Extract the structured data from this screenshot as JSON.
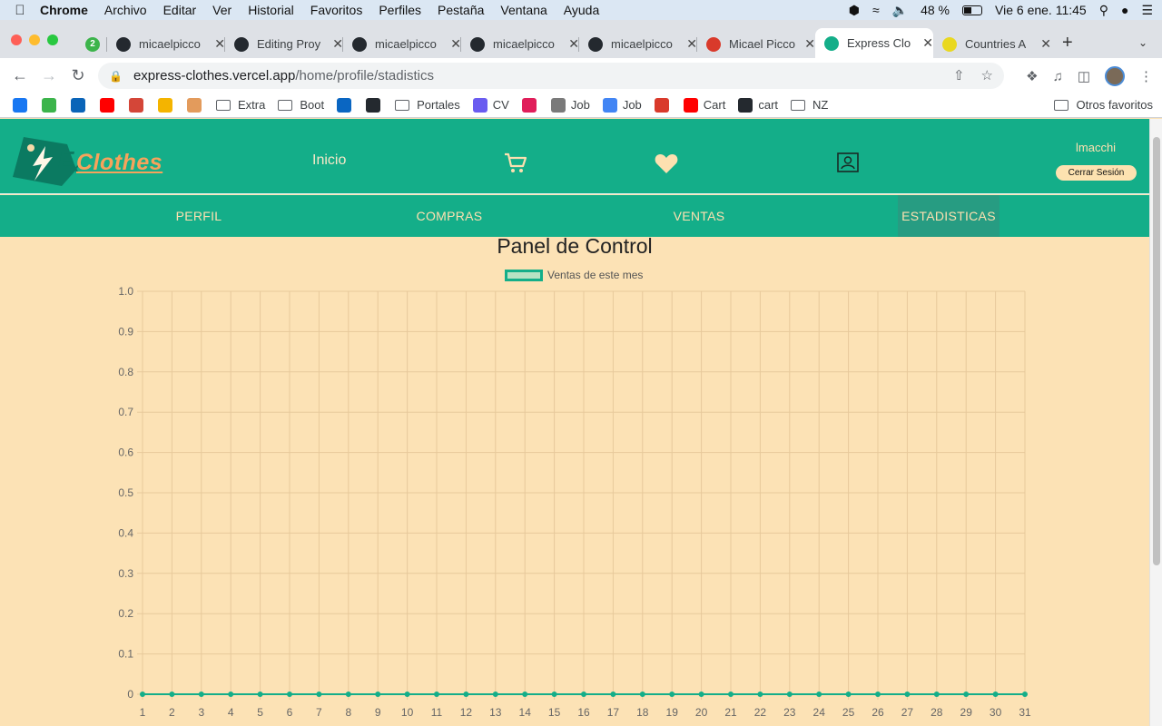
{
  "menubar": {
    "app": "Chrome",
    "items": [
      "Archivo",
      "Editar",
      "Ver",
      "Historial",
      "Favoritos",
      "Perfiles",
      "Pestaña",
      "Ventana",
      "Ayuda"
    ],
    "battery": "48 %",
    "battery_level": 0.48,
    "datetime": "Vie 6 ene.  11:45"
  },
  "tabs": [
    {
      "title": "",
      "badge": "2",
      "color": "#3cb44b"
    },
    {
      "title": "micaelpicco",
      "color": "#24292f"
    },
    {
      "title": "Editing Proy",
      "color": "#24292f"
    },
    {
      "title": "micaelpicco",
      "color": "#24292f"
    },
    {
      "title": "micaelpicco",
      "color": "#24292f"
    },
    {
      "title": "micaelpicco",
      "color": "#24292f"
    },
    {
      "title": "Micael Picco",
      "color": "#d93a2b"
    },
    {
      "title": "Express Clo",
      "color": "#14ae89",
      "active": true
    },
    {
      "title": "Countries A",
      "color": "#e9d820"
    }
  ],
  "address": {
    "host": "express-clothes.vercel.app",
    "path": "/home/profile/stadistics"
  },
  "bookmarks": [
    {
      "label": "",
      "icon": "facebook-icon",
      "color": "#1877f2"
    },
    {
      "label": "",
      "icon": "badge-icon",
      "color": "#3cb44b"
    },
    {
      "label": "",
      "icon": "outlook-icon",
      "color": "#0a64b8"
    },
    {
      "label": "",
      "icon": "youtube-icon",
      "color": "#ff0000"
    },
    {
      "label": "",
      "icon": "gmail-icon",
      "color": "#d44638"
    },
    {
      "label": "",
      "icon": "drive-icon",
      "color": "#f4b400"
    },
    {
      "label": "",
      "icon": "box-icon",
      "color": "#e39b5c"
    },
    {
      "label": "Extra",
      "icon": "folder-icon",
      "folder": true
    },
    {
      "label": "Boot",
      "icon": "folder-icon",
      "folder": true
    },
    {
      "label": "",
      "icon": "linkedin-icon",
      "color": "#0a66c2"
    },
    {
      "label": "",
      "icon": "github-icon",
      "color": "#24292f"
    },
    {
      "label": "Portales",
      "icon": "folder-icon",
      "folder": true
    },
    {
      "label": "CV",
      "icon": "cv-icon",
      "color": "#6a5cf0"
    },
    {
      "label": "",
      "icon": "slack-icon",
      "color": "#e01e5a"
    },
    {
      "label": "Job",
      "icon": "search-icon",
      "color": "#7a7a7a"
    },
    {
      "label": "Job",
      "icon": "docs-icon",
      "color": "#4285f4"
    },
    {
      "label": "",
      "icon": "target-icon",
      "color": "#d93a2b"
    },
    {
      "label": "Cart",
      "icon": "youtube-icon",
      "color": "#ff0000"
    },
    {
      "label": "cart",
      "icon": "github-icon",
      "color": "#24292f"
    },
    {
      "label": "NZ",
      "icon": "folder-icon",
      "folder": true
    }
  ],
  "other_bookmarks": "Otros favoritos",
  "site": {
    "logo_text": "Clothes",
    "nav_home": "Inicio",
    "username": "lmacchi",
    "logout": "Cerrar Sesión",
    "subnav": [
      "PERFIL",
      "COMPRAS",
      "VENTAS",
      "ESTADISTICAS"
    ],
    "active_subnav": "ESTADISTICAS",
    "panel_title": "Panel de Control"
  },
  "chart_data": {
    "type": "line",
    "x": [
      1,
      2,
      3,
      4,
      5,
      6,
      7,
      8,
      9,
      10,
      11,
      12,
      13,
      14,
      15,
      16,
      17,
      18,
      19,
      20,
      21,
      22,
      23,
      24,
      25,
      26,
      27,
      28,
      29,
      30,
      31
    ],
    "series": [
      {
        "name": "Ventas de este mes",
        "values": [
          0,
          0,
          0,
          0,
          0,
          0,
          0,
          0,
          0,
          0,
          0,
          0,
          0,
          0,
          0,
          0,
          0,
          0,
          0,
          0,
          0,
          0,
          0,
          0,
          0,
          0,
          0,
          0,
          0,
          0,
          0
        ],
        "color": "#14ae89"
      }
    ],
    "y_ticks": [
      "1.0",
      "0.9",
      "0.8",
      "0.7",
      "0.6",
      "0.5",
      "0.4",
      "0.3",
      "0.2",
      "0.1",
      "0"
    ],
    "ylim": [
      0,
      1
    ],
    "grid": true,
    "legend": "top-center"
  }
}
